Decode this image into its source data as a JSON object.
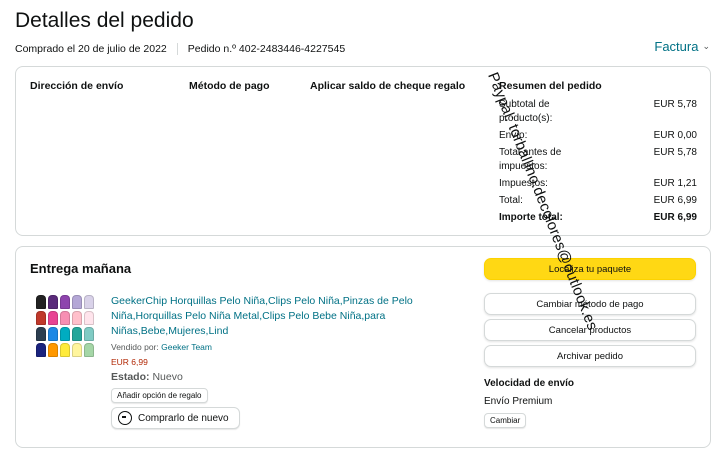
{
  "header": {
    "title": "Detalles del pedido",
    "order_date": "Comprado el 20 de julio de 2022",
    "order_number": "Pedido n.º 402-2483446-4227545",
    "invoice_label": "Factura"
  },
  "info": {
    "shipping_address_label": "Dirección de envío",
    "payment_method_label": "Método de pago",
    "gift_balance_label": "Aplicar saldo de cheque regalo"
  },
  "summary": {
    "title": "Resumen del pedido",
    "rows": [
      {
        "label": "Subtotal de producto(s):",
        "value": "EUR 5,78"
      },
      {
        "label": "Envío:",
        "value": "EUR 0,00"
      },
      {
        "label": "Total antes de impuestos:",
        "value": "EUR 5,78"
      },
      {
        "label": "Impuestos:",
        "value": "EUR 1,21"
      },
      {
        "label": "Total:",
        "value": "EUR 6,99"
      },
      {
        "label": "Importe total:",
        "value": "EUR 6,99"
      }
    ]
  },
  "delivery": {
    "heading": "Entrega mañana",
    "product_title": "GeekerChip Horquillas Pelo Niña,Clips Pelo Niña,Pinzas de Pelo Niña,Horquillas Pelo Niña Metal,Clips Pelo Bebe Niña,para Niñas,Bebe,Mujeres,Lind",
    "sold_by_label": "Vendido por:",
    "seller": "Geeker Team",
    "price": "EUR 6,99",
    "status_label": "Estado:",
    "status_value": "Nuevo",
    "gift_option": "Añadir opción de regalo",
    "buy_again": "Comprarlo de nuevo",
    "thumb_colors": [
      "#222222",
      "#5a2a7a",
      "#8e44ad",
      "#b4a7d6",
      "#d9d2e9",
      "#c0392b",
      "#e84393",
      "#f78fb3",
      "#ffc0cb",
      "#ffe4ec",
      "#2c3e50",
      "#1e88e5",
      "#00acc1",
      "#26a69a",
      "#80cbc4",
      "#1a237e",
      "#ff9800",
      "#ffeb3b",
      "#fff59d",
      "#a5d6a7",
      "#9ccc65",
      "#f48fb1",
      "#ce93d8",
      "#ffffff",
      "#fafafa"
    ]
  },
  "actions": {
    "track": "Localiza tu paquete",
    "change_payment": "Cambiar método de pago",
    "cancel": "Cancelar productos",
    "archive": "Archivar pedido",
    "speed_label": "Velocidad de envío",
    "speed_value": "Envío Premium",
    "change": "Cambiar"
  },
  "overlay_text": "Paypal: torballino.decolores@outlook.es"
}
